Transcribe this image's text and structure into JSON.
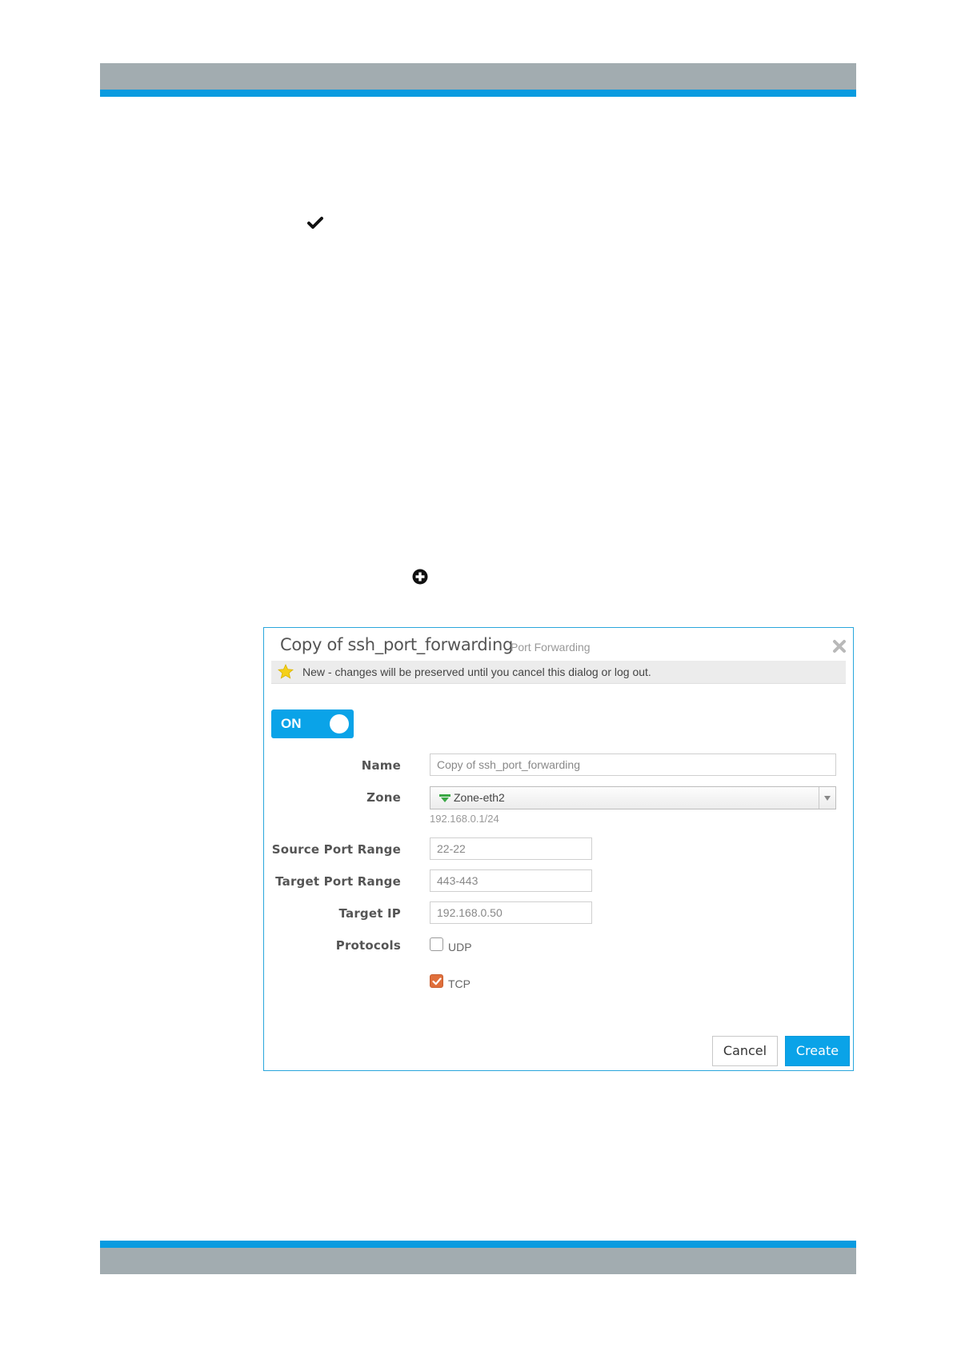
{
  "dialog": {
    "title": "Copy of ssh_port_forwarding",
    "subtitle": "Port Forwarding",
    "notice": "New - changes will be preserved until you cancel this dialog or log out.",
    "toggle_label": "ON",
    "toggle_state": "on",
    "fields": {
      "name_label": "Name",
      "name_value": "Copy of ssh_port_forwarding",
      "zone_label": "Zone",
      "zone_value": "Zone-eth2",
      "zone_subnet": "192.168.0.1/24",
      "source_port_label": "Source Port Range",
      "source_port_value": "22-22",
      "target_port_label": "Target Port Range",
      "target_port_value": "443-443",
      "target_ip_label": "Target IP",
      "target_ip_value": "192.168.0.50",
      "protocols_label": "Protocols"
    },
    "protocols": [
      {
        "label": "UDP",
        "checked": false
      },
      {
        "label": "TCP",
        "checked": true
      }
    ],
    "buttons": {
      "cancel": "Cancel",
      "create": "Create"
    }
  },
  "colors": {
    "accent": "#0aa3e8",
    "header_gray": "#a2acb0",
    "checkbox_checked": "#e06f3b",
    "notice_bg": "#ececec",
    "star": "#f5d01a",
    "zone_icon": "#3aa845"
  },
  "icons": [
    "checkmark-icon",
    "plus-circle-icon",
    "close-icon",
    "star-icon",
    "zone-icon",
    "dropdown-arrow-icon"
  ]
}
